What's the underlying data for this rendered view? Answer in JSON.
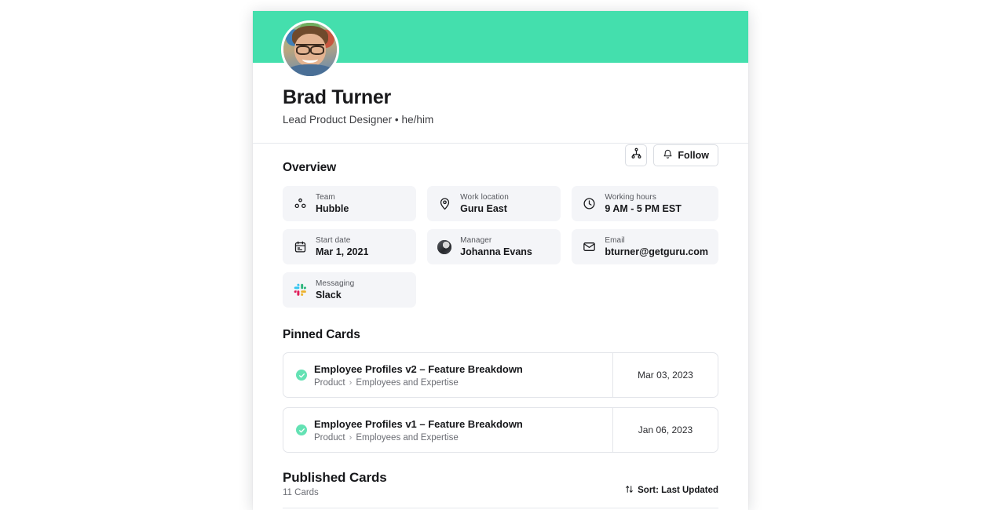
{
  "profile": {
    "name": "Brad Turner",
    "subtitle": "Lead Product Designer • he/him",
    "banner_color": "#44dfad",
    "avatar_icon": "user-photo",
    "actions": {
      "org_chart_icon": "org-chart-icon",
      "follow_icon": "bell-icon",
      "follow_label": "Follow"
    }
  },
  "overview": {
    "title": "Overview",
    "items": [
      {
        "icon": "people-group-icon",
        "label": "Team",
        "value": "Hubble"
      },
      {
        "icon": "map-pin-icon",
        "label": "Work location",
        "value": "Guru East"
      },
      {
        "icon": "clock-icon",
        "label": "Working hours",
        "value": "9 AM - 5 PM EST"
      },
      {
        "icon": "calendar-icon",
        "label": "Start date",
        "value": "Mar 1, 2021"
      },
      {
        "icon": "manager-avatar",
        "label": "Manager",
        "value": "Johanna Evans"
      },
      {
        "icon": "envelope-icon",
        "label": "Email",
        "value": "bturner@getguru.com"
      },
      {
        "icon": "slack-logo-icon",
        "label": "Messaging",
        "value": "Slack"
      }
    ]
  },
  "pinned": {
    "title": "Pinned Cards",
    "cards": [
      {
        "verified_icon": "verified-check-icon",
        "title": "Employee Profiles v2 – Feature Breakdown",
        "breadcrumb_parent": "Product",
        "breadcrumb_sep": "›",
        "breadcrumb_child": "Employees and Expertise",
        "date": "Mar 03, 2023"
      },
      {
        "verified_icon": "verified-check-icon",
        "title": "Employee Profiles v1 – Feature Breakdown",
        "breadcrumb_parent": "Product",
        "breadcrumb_sep": "›",
        "breadcrumb_child": "Employees and Expertise",
        "date": "Jan 06, 2023"
      }
    ]
  },
  "published": {
    "title": "Published Cards",
    "count_label": "11 Cards",
    "sort_icon": "sort-arrows-icon",
    "sort_label": "Sort: Last Updated"
  }
}
